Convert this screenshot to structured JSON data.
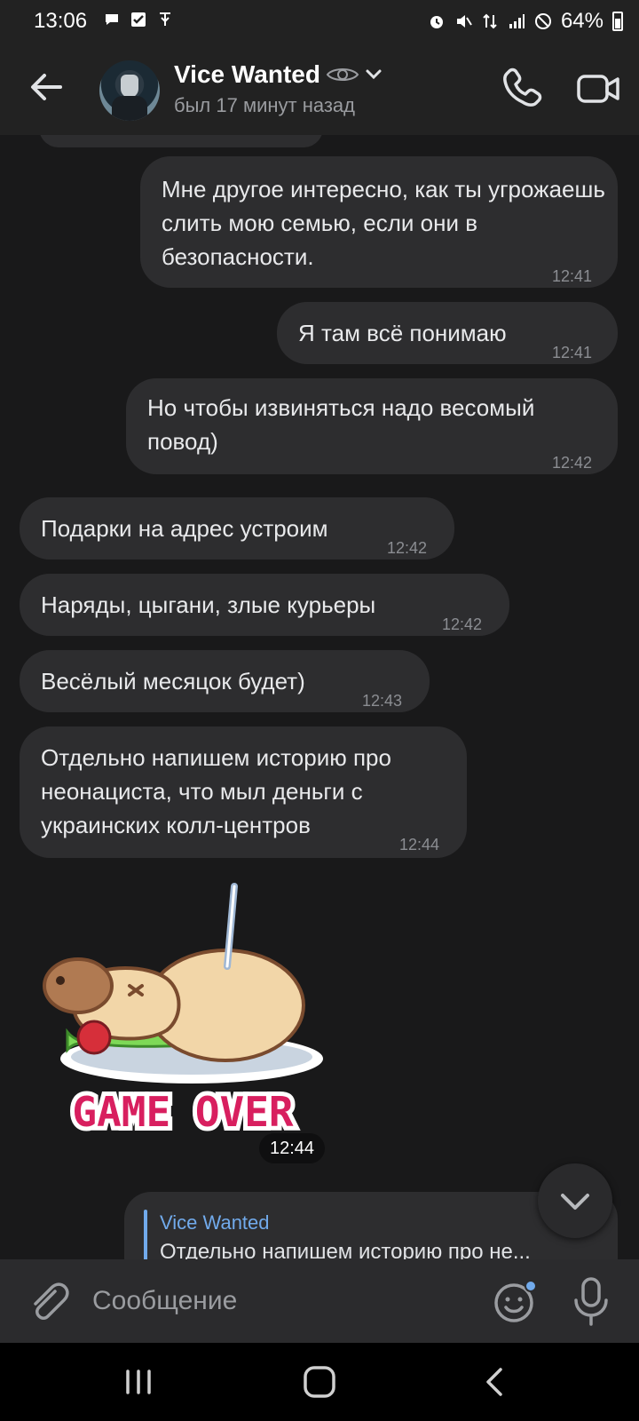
{
  "status_bar": {
    "time": "13:06",
    "battery": "64%"
  },
  "header": {
    "contact_name": "Vice Wanted",
    "contact_status": "был 17 минут назад"
  },
  "messages": [
    {
      "direction": "outgoing",
      "text": "Мне другое интересно, как ты угрожаешь слить мою семью, если они в безопасности.",
      "time": "12:41"
    },
    {
      "direction": "outgoing",
      "text": "Я там всё понимаю",
      "time": "12:41"
    },
    {
      "direction": "outgoing",
      "text": "Но чтобы извиняться надо весомый повод)",
      "time": "12:42"
    },
    {
      "direction": "incoming",
      "text": "Подарки на адрес устроим",
      "time": "12:42"
    },
    {
      "direction": "incoming",
      "text": "Наряды, цыгани, злые курьеры",
      "time": "12:42"
    },
    {
      "direction": "incoming",
      "text": "Весёлый месяцок будет)",
      "time": "12:43"
    },
    {
      "direction": "incoming",
      "text": "Отдельно напишем историю про неонациста, что мыл деньги с украинских колл-центров",
      "time": "12:44"
    }
  ],
  "sticker": {
    "caption": "GAME OVER",
    "time": "12:44"
  },
  "reply": {
    "author": "Vice Wanted",
    "quoted_text": "Отдельно напишем историю про не..."
  },
  "input": {
    "placeholder": "Сообщение"
  },
  "colors": {
    "background": "#19191a",
    "bubble": "#2d2d2f",
    "accent": "#71aaeb"
  },
  "icons": {
    "back": "arrow-left-icon",
    "call": "phone-icon",
    "video": "video-camera-icon",
    "attach": "paperclip-icon",
    "emoji": "smile-icon",
    "mic": "microphone-icon",
    "scroll": "chevron-down-icon"
  }
}
